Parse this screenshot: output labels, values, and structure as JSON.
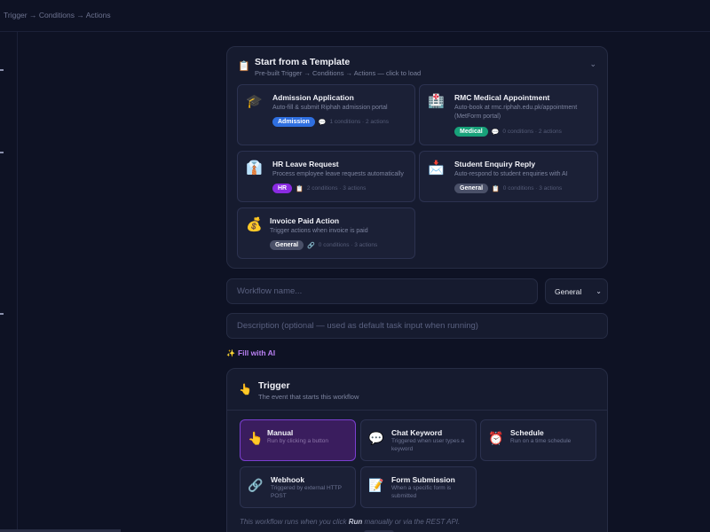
{
  "header": {
    "breadcrumb": "Trigger → Conditions → Actions"
  },
  "templates": {
    "title": "Start from a Template",
    "subtitle": "Pre-built Trigger → Conditions → Actions — click to load",
    "items": [
      {
        "icon": "🎓",
        "name": "Admission Application",
        "desc": "Auto-fill & submit Riphah admission portal",
        "badge": "Admission",
        "badge_color": "#2f6fe0",
        "meta_icon": "💬",
        "meta": "1 conditions · 2 actions"
      },
      {
        "icon": "🏥",
        "name": "RMC Medical Appointment",
        "desc": "Auto-book at rmc.riphah.edu.pk/appointment (MetForm portal)",
        "badge": "Medical",
        "badge_color": "#18a27a",
        "meta_icon": "💬",
        "meta": "0 conditions · 2 actions"
      },
      {
        "icon": "👔",
        "name": "HR Leave Request",
        "desc": "Process employee leave requests automatically",
        "badge": "HR",
        "badge_color": "#8a2be2",
        "meta_icon": "📋",
        "meta": "2 conditions · 3 actions"
      },
      {
        "icon": "📩",
        "name": "Student Enquiry Reply",
        "desc": "Auto-respond to student enquiries with AI",
        "badge": "General",
        "badge_color": "#4a5068",
        "meta_icon": "📋",
        "meta": "0 conditions · 3 actions"
      },
      {
        "icon": "💰",
        "name": "Invoice Paid Action",
        "desc": "Trigger actions when invoice is paid",
        "badge": "General",
        "badge_color": "#4a5068",
        "meta_icon": "🔗",
        "meta": "0 conditions · 3 actions"
      }
    ]
  },
  "form": {
    "name_placeholder": "Workflow name...",
    "category_value": "General",
    "desc_placeholder": "Description (optional — used as default task input when running)",
    "fill_ai_icon": "✨",
    "fill_ai_label": "Fill with AI"
  },
  "trigger": {
    "icon": "👆",
    "title": "Trigger",
    "subtitle": "The event that starts this workflow",
    "options": [
      {
        "icon": "👆",
        "name": "Manual",
        "desc": "Run by clicking a button",
        "active": true
      },
      {
        "icon": "💬",
        "name": "Chat Keyword",
        "desc": "Triggered when user types a keyword",
        "active": false
      },
      {
        "icon": "⏰",
        "name": "Schedule",
        "desc": "Run on a time schedule",
        "active": false
      },
      {
        "icon": "🔗",
        "name": "Webhook",
        "desc": "Triggered by external HTTP POST",
        "active": false
      },
      {
        "icon": "📝",
        "name": "Form Submission",
        "desc": "When a specific form is submitted",
        "active": false
      }
    ],
    "help_prefix": "This workflow runs when you click ",
    "help_bold": "Run",
    "help_suffix": " manually or via the REST API."
  },
  "colors": {
    "background": "#0e1224",
    "panel": "#161b2f",
    "accent_purple": "#b880f2",
    "active_trigger": "#3a1d5e"
  }
}
